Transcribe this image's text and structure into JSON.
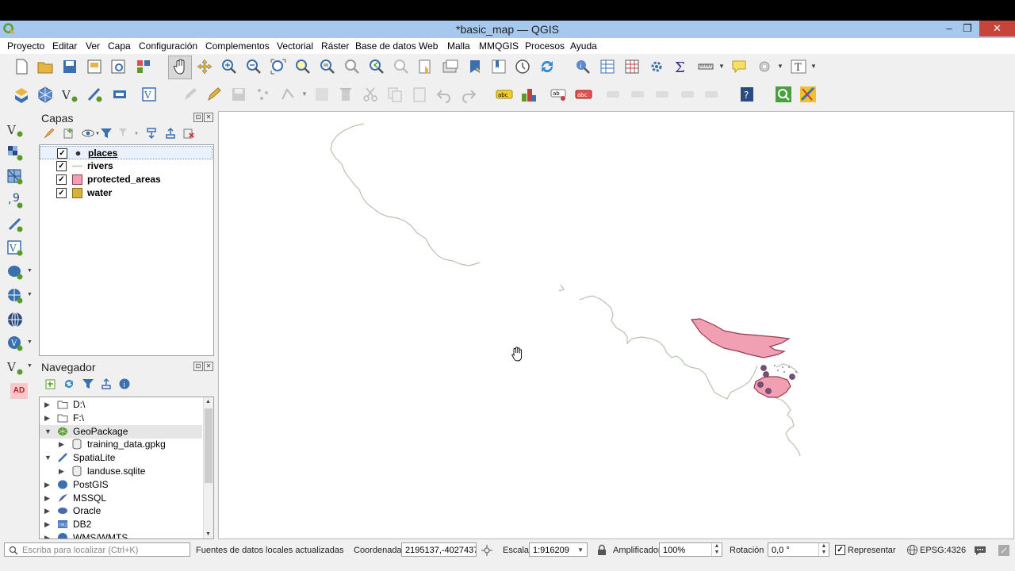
{
  "window": {
    "title": "*basic_map — QGIS",
    "minimize": "–",
    "restore": "❐",
    "close": "✕"
  },
  "menu": [
    "Proyecto",
    "Editar",
    "Ver",
    "Capa",
    "Configuración",
    "Complementos",
    "Vectorial",
    "Ráster",
    "Base de datos",
    "Web",
    "Malla",
    "MMQGIS",
    "Procesos",
    "Ayuda"
  ],
  "layers_panel": {
    "title": "Capas",
    "float_btn": "⊡",
    "close_btn": "✕",
    "layers": [
      {
        "name": "places",
        "checked": "✓",
        "symbol": "point",
        "color": "#333333"
      },
      {
        "name": "rivers",
        "checked": "✓",
        "symbol": "line",
        "color": "#b5c4ad"
      },
      {
        "name": "protected_areas",
        "checked": "✓",
        "symbol": "fill",
        "color": "#f0a0b2"
      },
      {
        "name": "water",
        "checked": "✓",
        "symbol": "fill",
        "color": "#d6b23c"
      }
    ]
  },
  "browser_panel": {
    "title": "Navegador",
    "float_btn": "⊡",
    "close_btn": "✕",
    "items": [
      {
        "label": "D:\\",
        "arrow": "▶",
        "icon": "folder-icon",
        "indent": 0
      },
      {
        "label": "F:\\",
        "arrow": "▶",
        "icon": "folder-icon",
        "indent": 0
      },
      {
        "label": "GeoPackage",
        "arrow": "▼",
        "icon": "geopackage-icon",
        "indent": 0
      },
      {
        "label": "training_data.gpkg",
        "arrow": "▶",
        "icon": "database-icon",
        "indent": 1
      },
      {
        "label": "SpatiaLite",
        "arrow": "▼",
        "icon": "spatialite-icon",
        "indent": 0
      },
      {
        "label": "landuse.sqlite",
        "arrow": "▶",
        "icon": "database-icon",
        "indent": 1
      },
      {
        "label": "PostGIS",
        "arrow": "▶",
        "icon": "postgis-icon",
        "indent": 0
      },
      {
        "label": "MSSQL",
        "arrow": "▶",
        "icon": "mssql-icon",
        "indent": 0
      },
      {
        "label": "Oracle",
        "arrow": "▶",
        "icon": "oracle-icon",
        "indent": 0
      },
      {
        "label": "DB2",
        "arrow": "▶",
        "icon": "db2-icon",
        "indent": 0
      },
      {
        "label": "WMS/WMTS",
        "arrow": "▶",
        "icon": "wms-icon",
        "indent": 0
      }
    ]
  },
  "sidebar": {
    "ad_badge": "AD"
  },
  "status": {
    "search_placeholder": "Escriba para localizar (Ctrl+K)",
    "message": "Fuentes de datos locales actualizadas",
    "coord_label": "Coordenada",
    "coord_value": "2195137,-4027437",
    "scale_label": "Escala",
    "scale_value": "1:916209",
    "magnifier_label": "Amplificador",
    "magnifier_value": "100%",
    "rotation_label": "Rotación",
    "rotation_value": "0,0 °",
    "render_label": "Representar",
    "render_checked": "✓",
    "crs": "EPSG:4326"
  },
  "colors": {
    "titlebar": "#a6c8ef",
    "close": "#c7443a",
    "river": "#b5c4ad",
    "protected_fill": "#f0a0b2",
    "protected_stroke": "#9a3a52",
    "place": "#7a4d7a"
  }
}
